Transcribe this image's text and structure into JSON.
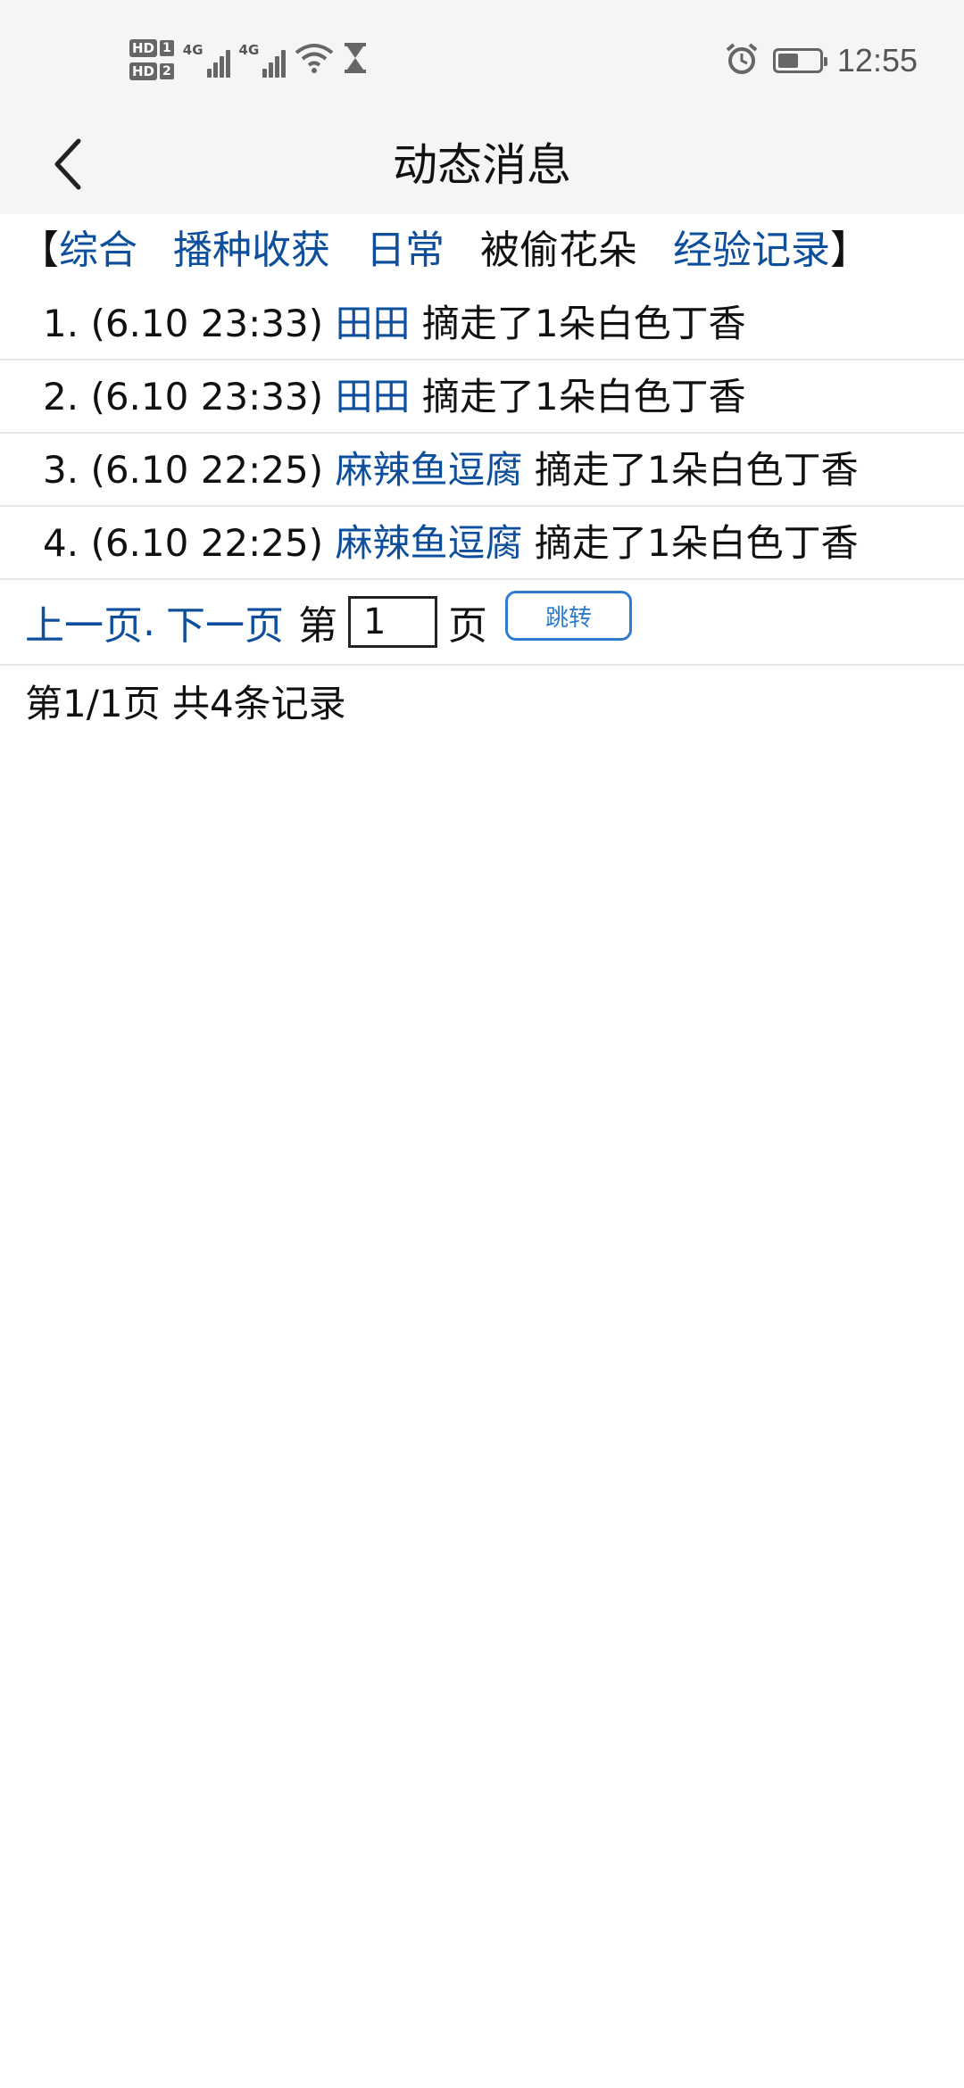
{
  "status_bar": {
    "sim1_badge": "HD",
    "sim1_num": "1",
    "sim2_badge": "HD",
    "sim2_num": "2",
    "net1": "4G",
    "net2": "4G",
    "time": "12:55",
    "battery_level": 0.5,
    "icons": [
      "wifi-icon",
      "hourglass-icon",
      "alarm-icon",
      "battery-icon"
    ]
  },
  "header": {
    "title": "动态消息",
    "back_icon": "chevron-left-icon"
  },
  "tabs": {
    "open_bracket": "【",
    "close_bracket": "】",
    "items": [
      {
        "label": "综合"
      },
      {
        "label": "播种收获"
      },
      {
        "label": "日常"
      },
      {
        "label": "被偷花朵"
      },
      {
        "label": "经验记录"
      }
    ],
    "current_index": 3
  },
  "records": [
    {
      "index": "1.",
      "time": "(6.10 23:33)",
      "user": "田田",
      "action": "摘走了1朵白色丁香"
    },
    {
      "index": "2.",
      "time": "(6.10 23:33)",
      "user": "田田",
      "action": "摘走了1朵白色丁香"
    },
    {
      "index": "3.",
      "time": "(6.10 22:25)",
      "user": "麻辣鱼逗腐",
      "action": "摘走了1朵白色丁香"
    },
    {
      "index": "4.",
      "time": "(6.10 22:25)",
      "user": "麻辣鱼逗腐",
      "action": "摘走了1朵白色丁香"
    }
  ],
  "pager": {
    "prev_label": "上一页",
    "separator": ".",
    "next_label": "下一页",
    "page_prefix": "第",
    "page_value": "1",
    "page_suffix": "页",
    "jump_label": "跳转"
  },
  "summary": {
    "text": "第1/1页 共4条记录"
  },
  "colors": {
    "link": "#0d4f9c",
    "button_border": "#2e7bd0",
    "header_bg": "#f5f5f5"
  }
}
